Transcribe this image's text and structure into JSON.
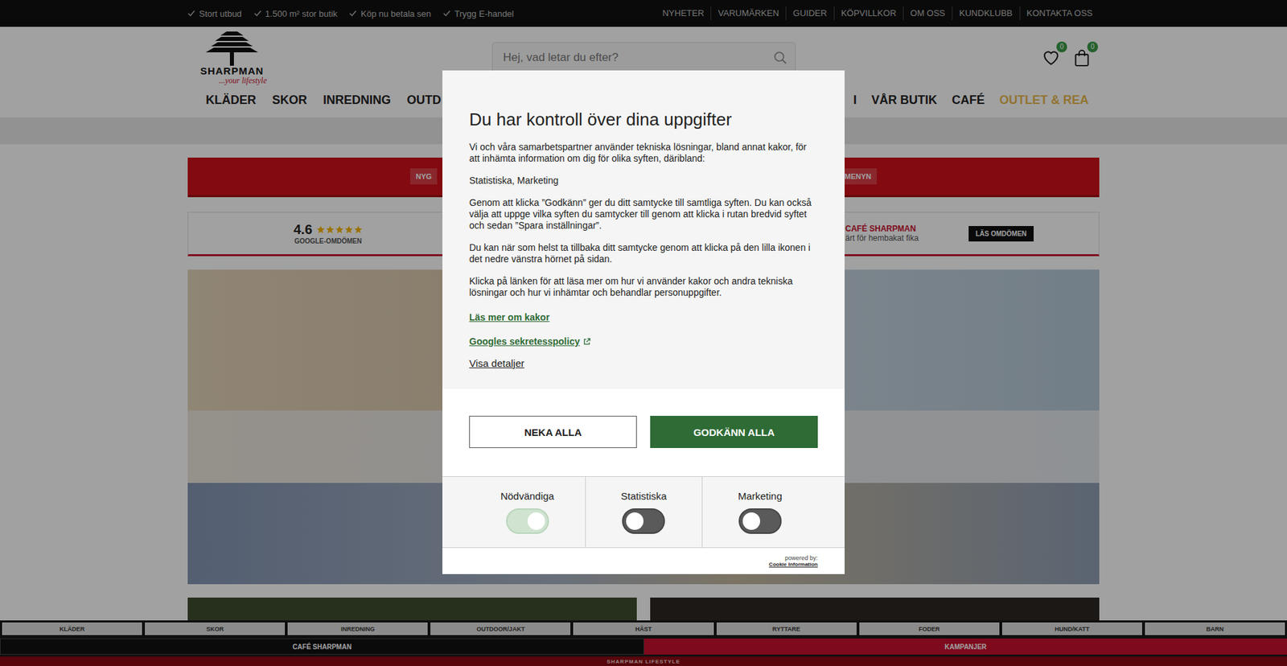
{
  "top_bar": {
    "usps": [
      "Stort utbud",
      "1.500 m² stor butik",
      "Köp nu betala sen",
      "Trygg E-handel"
    ],
    "links": [
      "NYHETER",
      "VARUMÄRKEN",
      "GUIDER",
      "KÖPVILLKOR",
      "OM OSS",
      "KUNDKLUBB",
      "KONTAKTA OSS"
    ]
  },
  "header": {
    "logo_name": "SHARPMAN",
    "logo_tagline": "...your lifestyle",
    "search": {
      "placeholder": "Hej, vad letar du efter?"
    },
    "wishlist_count": "0",
    "cart_count": "0"
  },
  "nav": {
    "left": [
      {
        "label": "KLÄDER",
        "highlight": false
      },
      {
        "label": "SKOR",
        "highlight": false
      },
      {
        "label": "INREDNING",
        "highlight": false
      },
      {
        "label": "OUTD",
        "highlight": false
      }
    ],
    "right": [
      {
        "label": "I",
        "highlight": false
      },
      {
        "label": "VÅR BUTIK",
        "highlight": false
      },
      {
        "label": "CAFÉ",
        "highlight": false
      },
      {
        "label": "OUTLET & REA",
        "highlight": true
      }
    ]
  },
  "banner": {
    "left": "NYG",
    "right": "MENYN"
  },
  "reviews": {
    "score": "4.6",
    "stars": 5,
    "source": "GOOGLE-OMDÖMEN",
    "cafe_title": "CAFÉ SHARPMAN",
    "cafe_text": "ärt för hembakat fika",
    "button": "LÄS OMDÖMEN"
  },
  "bottom_bar": {
    "categories": [
      "KLÄDER",
      "SKOR",
      "INREDNING",
      "OUTDOOR/JAKT",
      "HÄST",
      "RYTTARE",
      "FODER",
      "HUND/KATT",
      "BARN"
    ],
    "cafe": "CAFÉ SHARPMAN",
    "campaigns": "KAMPANJER",
    "footer": "SHARPMAN LIFESTYLE"
  },
  "cookie_dialog": {
    "title": "Du har kontroll över dina uppgifter",
    "paragraphs": [
      "Vi och våra samarbetspartner använder tekniska lösningar, bland annat kakor, för att inhämta information om dig för olika syften, däribland:",
      "Statistiska, Marketing",
      "Genom att klicka ”Godkänn” ger du ditt samtycke till samtliga syften. Du kan också välja att uppge vilka syften du samtycker till genom att klicka i rutan bredvid syftet och sedan ”Spara inställningar”.",
      "Du kan när som helst ta tillbaka ditt samtycke genom att klicka på den lilla ikonen i det nedre vänstra hörnet på sidan.",
      "Klicka på länken för att läsa mer om hur vi använder kakor och andra tekniska lösningar och hur vi inhämtar och behandlar personuppgifter."
    ],
    "links": [
      {
        "label": "Läs mer om kakor",
        "external": false
      },
      {
        "label": "Googles sekretesspolicy",
        "external": true
      }
    ],
    "details": "Visa detaljer",
    "buttons": [
      {
        "label": "NEKA ALLA",
        "primary": false
      },
      {
        "label": "GODKÄNN ALLA",
        "primary": true
      }
    ],
    "purposes": [
      {
        "label": "Nödvändiga",
        "on": true,
        "disabled": true
      },
      {
        "label": "Statistiska",
        "on": false,
        "disabled": false
      },
      {
        "label": "Marketing",
        "on": false,
        "disabled": false
      }
    ],
    "powered_by": "powered by:",
    "provider": "Cookie Information"
  }
}
